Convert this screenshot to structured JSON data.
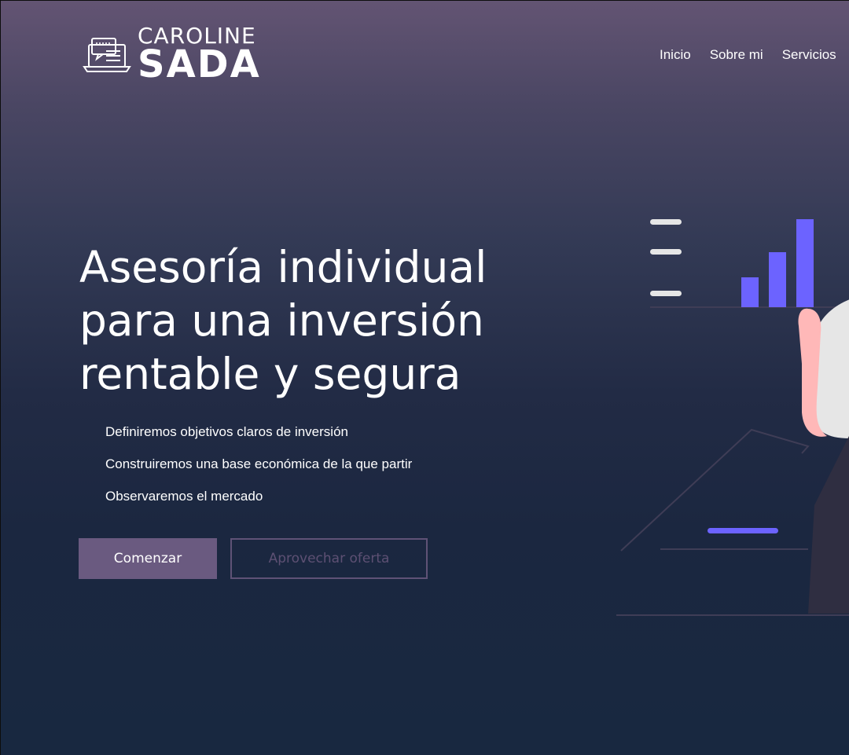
{
  "brand": {
    "name_top": "CAROLINE",
    "name_bottom": "SADA",
    "icon": "laptop-chat-icon"
  },
  "nav": {
    "items": [
      {
        "label": "Inicio"
      },
      {
        "label": "Sobre mi"
      },
      {
        "label": "Servicios"
      }
    ]
  },
  "hero": {
    "title_lines": [
      "Asesoría individual",
      "para una inversión",
      "rentable y segura"
    ],
    "features": [
      "Definiremos objetivos claros de inversión",
      "Construiremos una base económica de la que partir",
      "Observaremos el mercado"
    ],
    "primary_button": "Comenzar",
    "secondary_button": "Aprovechar oferta"
  },
  "illustration": {
    "icon": "presentation-chart-illustration",
    "accent_color": "#6c63ff"
  },
  "colors": {
    "primary_button": "#6a5a80",
    "secondary_border": "#5f5276",
    "background_top": "#635473",
    "background_bottom": "#182840"
  }
}
